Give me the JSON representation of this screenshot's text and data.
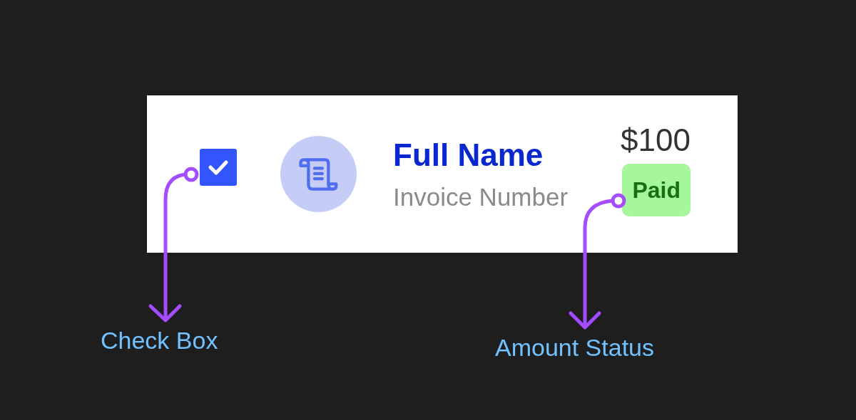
{
  "invoice_row": {
    "checked": true,
    "full_name": "Full Name",
    "invoice_number": "Invoice Number",
    "amount": "$100",
    "status": "Paid"
  },
  "annotations": [
    {
      "label": "Check Box"
    },
    {
      "label": "Amount Status"
    }
  ]
}
